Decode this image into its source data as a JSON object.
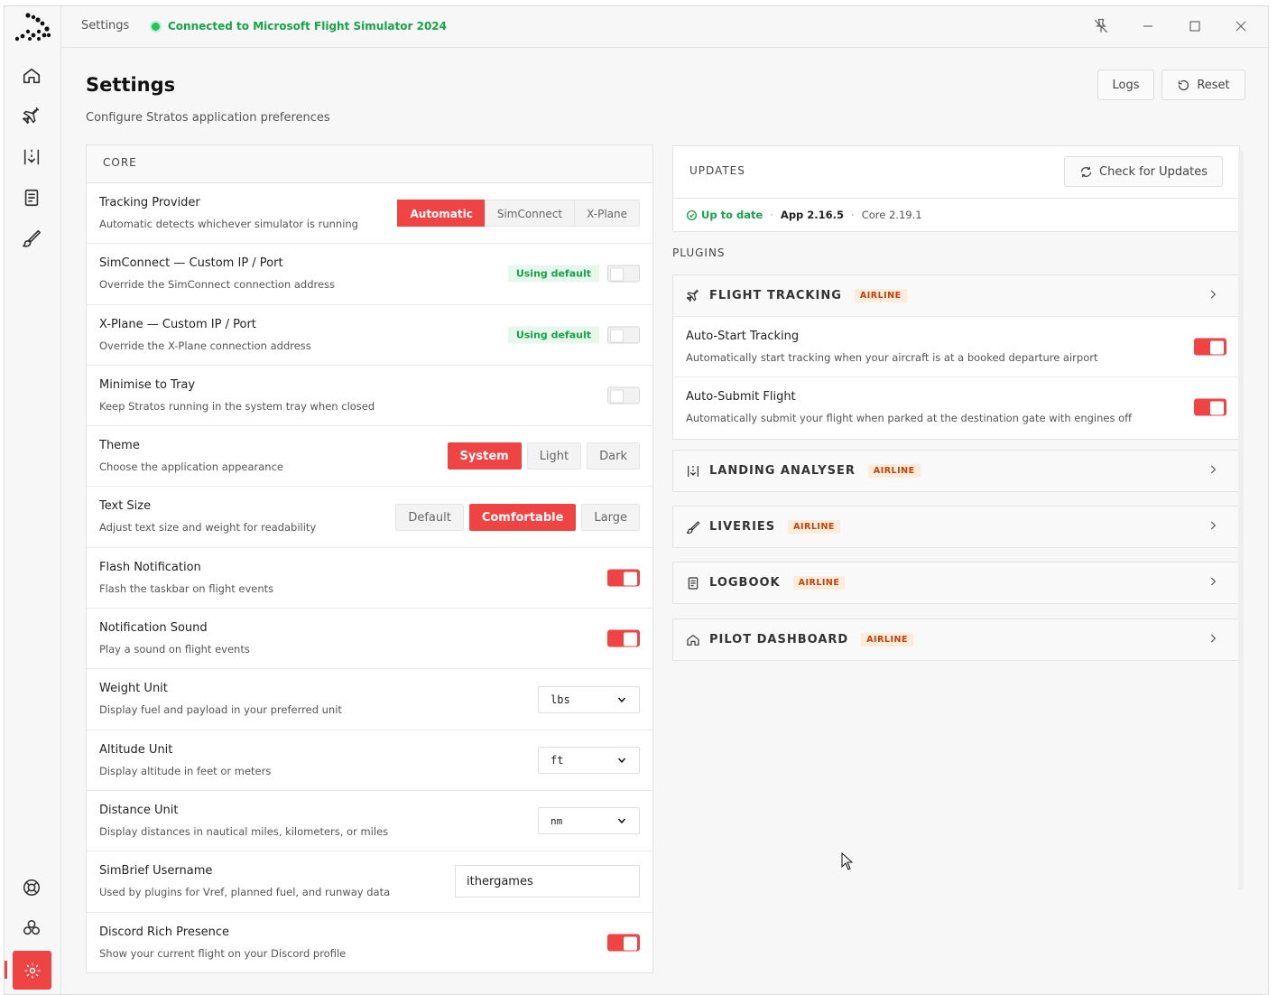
{
  "titlebar": {
    "title": "Settings",
    "status": "Connected to Microsoft Flight Simulator 2024"
  },
  "header": {
    "title": "Settings",
    "subtitle": "Configure Stratos application preferences",
    "logs_label": "Logs",
    "reset_label": "Reset"
  },
  "core": {
    "heading": "CORE",
    "tracking": {
      "label": "Tracking Provider",
      "desc": "Automatic detects whichever simulator is running",
      "options": [
        "Automatic",
        "SimConnect",
        "X-Plane"
      ],
      "selected": "Automatic"
    },
    "simconnect_ip": {
      "label": "SimConnect — Custom IP / Port",
      "desc": "Override the SimConnect connection address",
      "badge": "Using default"
    },
    "xplane_ip": {
      "label": "X-Plane — Custom IP / Port",
      "desc": "Override the X-Plane connection address",
      "badge": "Using default"
    },
    "tray": {
      "label": "Minimise to Tray",
      "desc": "Keep Stratos running in the system tray when closed"
    },
    "theme": {
      "label": "Theme",
      "desc": "Choose the application appearance",
      "options": [
        "System",
        "Light",
        "Dark"
      ],
      "selected": "System"
    },
    "text_size": {
      "label": "Text Size",
      "desc": "Adjust text size and weight for readability",
      "options": [
        "Default",
        "Comfortable",
        "Large"
      ],
      "selected": "Comfortable"
    },
    "flash": {
      "label": "Flash Notification",
      "desc": "Flash the taskbar on flight events"
    },
    "sound": {
      "label": "Notification Sound",
      "desc": "Play a sound on flight events"
    },
    "weight": {
      "label": "Weight Unit",
      "desc": "Display fuel and payload in your preferred unit",
      "value": "lbs"
    },
    "altitude": {
      "label": "Altitude Unit",
      "desc": "Display altitude in feet or meters",
      "value": "ft"
    },
    "distance": {
      "label": "Distance Unit",
      "desc": "Display distances in nautical miles, kilometers, or miles",
      "value": "nm"
    },
    "simbrief": {
      "label": "SimBrief Username",
      "desc": "Used by plugins for Vref, planned fuel, and runway data",
      "value": "ithergames"
    },
    "discord": {
      "label": "Discord Rich Presence",
      "desc": "Show your current flight on your Discord profile"
    }
  },
  "updates": {
    "heading": "UPDATES",
    "check_label": "Check for Updates",
    "status": "Up to date",
    "app_version": "App 2.16.5",
    "core_version": "Core 2.19.1"
  },
  "plugins": {
    "heading": "PLUGINS",
    "badge": "AIRLINE",
    "flight_tracking": {
      "name": "FLIGHT TRACKING",
      "auto_start": {
        "label": "Auto-Start Tracking",
        "desc": "Automatically start tracking when your aircraft is at a booked departure airport"
      },
      "auto_submit": {
        "label": "Auto-Submit Flight",
        "desc": "Automatically submit your flight when parked at the destination gate with engines off"
      }
    },
    "landing": {
      "name": "LANDING ANALYSER"
    },
    "liveries": {
      "name": "LIVERIES"
    },
    "logbook": {
      "name": "LOGBOOK"
    },
    "dashboard": {
      "name": "PILOT DASHBOARD"
    }
  },
  "colors": {
    "accent": "#ef4444",
    "connected": "#16a34a",
    "airline_badge": "#c2410c"
  },
  "toggles": {
    "simconnect_ip": false,
    "xplane_ip": false,
    "tray": false,
    "flash": true,
    "sound": true,
    "discord": true,
    "auto_start": true,
    "auto_submit": true
  }
}
